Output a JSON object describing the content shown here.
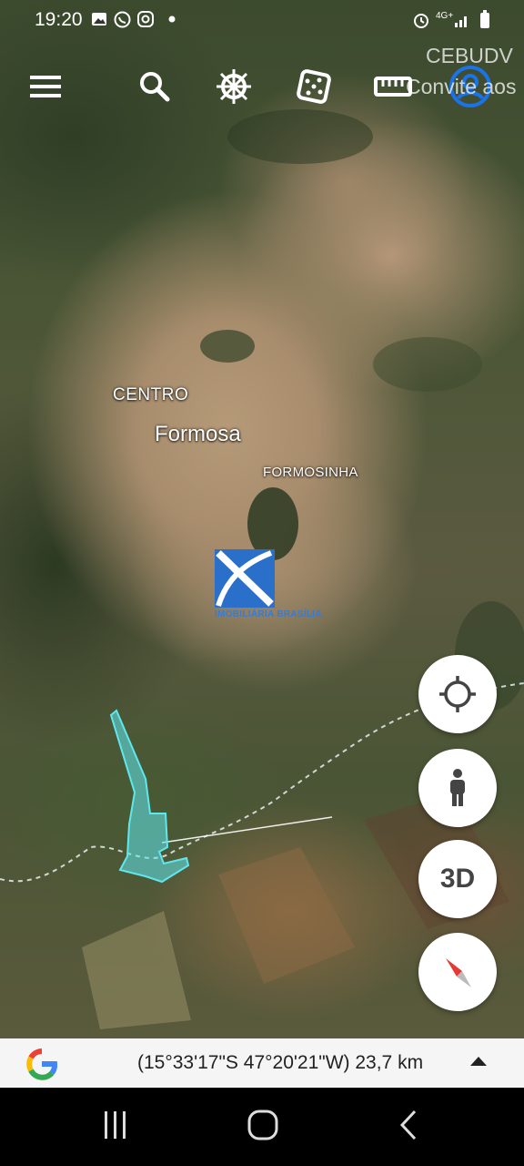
{
  "status_bar": {
    "time": "19:20",
    "network": "4G+"
  },
  "toolbar": {
    "items": [
      {
        "icon": "menu-icon"
      },
      {
        "icon": "search-icon"
      },
      {
        "icon": "voyager-wheel-icon"
      },
      {
        "icon": "feeling-lucky-dice-icon"
      },
      {
        "icon": "measure-ruler-icon"
      },
      {
        "icon": "account-icon"
      }
    ]
  },
  "overlay_text": {
    "cebudv": "CEBUDV",
    "convite": "Convite aos"
  },
  "map": {
    "labels": {
      "centro": "CENTRO",
      "formosa": "Formosa",
      "formosinha": "FORMOSINHA"
    },
    "watermark": "IMOBILIÁRIA BRASÍLIA",
    "parcel_color": "#5ee8ee"
  },
  "fabs": {
    "threed_label": "3D"
  },
  "info_bar": {
    "coordinates": "(15°33'17\"S 47°20'21\"W) 23,7 km"
  }
}
